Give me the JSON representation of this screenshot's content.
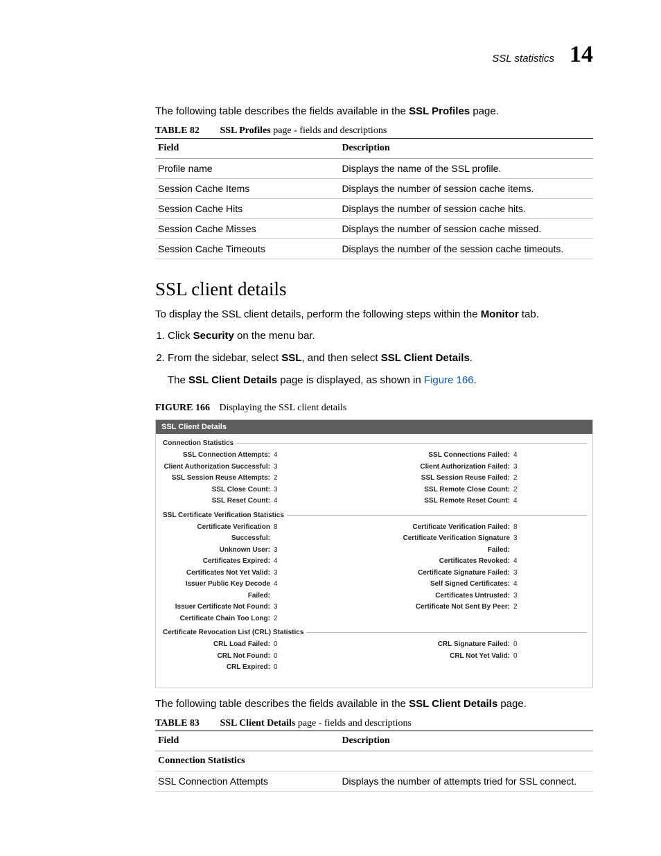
{
  "running_head": {
    "text": "SSL statistics",
    "chapter_num": "14"
  },
  "intro82": {
    "prefix": "The following table describes the fields available in the ",
    "bold": "SSL Profiles",
    "suffix": " page."
  },
  "table82": {
    "caption_num": "TABLE 82",
    "caption_bold": "SSL Profiles",
    "caption_rest": " page - fields and descriptions",
    "head_field": "Field",
    "head_desc": "Description",
    "rows": [
      {
        "field": "Profile name",
        "desc": "Displays the name of the SSL profile."
      },
      {
        "field": "Session Cache Items",
        "desc": "Displays the number of session cache items."
      },
      {
        "field": "Session Cache Hits",
        "desc": "Displays the number of session cache hits."
      },
      {
        "field": "Session Cache Misses",
        "desc": "Displays the number of session cache missed."
      },
      {
        "field": "Session Cache Timeouts",
        "desc": "Displays the number of the session cache timeouts."
      }
    ]
  },
  "heading": "SSL client details",
  "intro_client": {
    "prefix": "To display the SSL client details, perform the following steps within the ",
    "bold": "Monitor",
    "suffix": " tab."
  },
  "steps": {
    "s1": {
      "pre": "Click ",
      "b1": "Security",
      "post": " on the menu bar."
    },
    "s2": {
      "pre": "From the sidebar, select ",
      "b1": "SSL",
      "mid": ", and then select ",
      "b2": "SSL Client Details",
      "suffix": "."
    },
    "s2b": {
      "pre": "The ",
      "b1": "SSL Client Details",
      "mid": " page is displayed, as shown in ",
      "link": "Figure 166",
      "suffix": "."
    }
  },
  "figure": {
    "caption_num": "FIGURE 166",
    "caption_text": "Displaying the SSL client details",
    "title": "SSL Client Details",
    "sec1": {
      "legend": "Connection Statistics",
      "left": [
        {
          "label": "SSL Connection Attempts",
          "value": "4"
        },
        {
          "label": "Client Authorization Successful",
          "value": "3"
        },
        {
          "label": "SSL Session Reuse Attempts",
          "value": "2"
        },
        {
          "label": "SSL Close Count",
          "value": "3"
        },
        {
          "label": "SSL Reset Count",
          "value": "4"
        }
      ],
      "right": [
        {
          "label": "SSL Connections Failed",
          "value": "4"
        },
        {
          "label": "Client Authorization Failed",
          "value": "3"
        },
        {
          "label": "SSL Session Reuse Failed",
          "value": "2"
        },
        {
          "label": "SSL Remote Close Count",
          "value": "2"
        },
        {
          "label": "SSL Remote Reset Count",
          "value": "4"
        }
      ]
    },
    "sec2": {
      "legend": "SSL Certificate Verification Statistics",
      "left": [
        {
          "label": "Certificate Verification Successful",
          "value": "8"
        },
        {
          "label": "Unknown User",
          "value": "3"
        },
        {
          "label": "Certificates Expired",
          "value": "4"
        },
        {
          "label": "Certificates Not Yet Valid",
          "value": "3"
        },
        {
          "label": "Issuer Public Key Decode Failed",
          "value": "4"
        },
        {
          "label": "Issuer Certificate Not Found",
          "value": "3"
        },
        {
          "label": "Certificate Chain Too Long",
          "value": "2"
        }
      ],
      "right": [
        {
          "label": "Certificate Verification Failed",
          "value": "8"
        },
        {
          "label": "Certificate Verification Signature Failed",
          "value": "3"
        },
        {
          "label": "Certificates Revoked",
          "value": "4"
        },
        {
          "label": "Certificate Signature Failed",
          "value": "3"
        },
        {
          "label": "Self Signed Certificates",
          "value": "4"
        },
        {
          "label": "Certificates Untrusted",
          "value": "3"
        },
        {
          "label": "Certificate Not Sent By Peer",
          "value": "2"
        }
      ]
    },
    "sec3": {
      "legend": "Certificate Revocation List (CRL) Statistics",
      "left": [
        {
          "label": "CRL Load Failed",
          "value": "0"
        },
        {
          "label": "CRL Not Found",
          "value": "0"
        },
        {
          "label": "CRL Expired",
          "value": "0"
        }
      ],
      "right": [
        {
          "label": "CRL Signature Failed",
          "value": "0"
        },
        {
          "label": "CRL Not Yet Valid",
          "value": "0"
        }
      ]
    }
  },
  "intro83": {
    "prefix": "The following table describes the fields available in the ",
    "bold": "SSL Client Details",
    "suffix": " page."
  },
  "table83": {
    "caption_num": "TABLE 83",
    "caption_bold": "SSL Client Details",
    "caption_rest": " page - fields and descriptions",
    "head_field": "Field",
    "head_desc": "Description",
    "section": "Connection Statistics",
    "rows": [
      {
        "field": "SSL Connection Attempts",
        "desc": "Displays the number of attempts tried for SSL connect."
      }
    ]
  }
}
